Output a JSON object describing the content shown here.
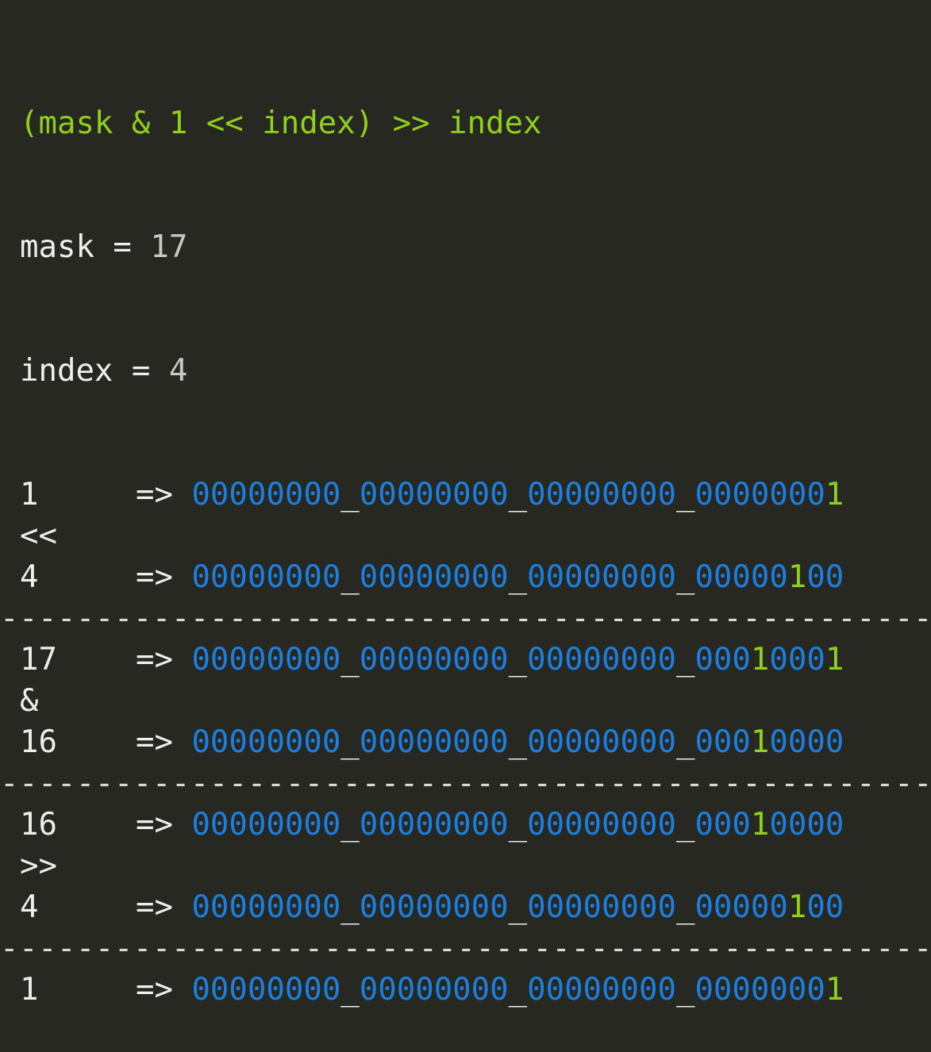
{
  "expression": "(mask & 1 << index) >> index",
  "vars": {
    "mask_name": "mask",
    "mask_eq": " = ",
    "mask_value": "17",
    "index_name": "index",
    "index_eq": " = ",
    "index_value": "4"
  },
  "arrow": "=>",
  "separator": "--------------------------------------------------",
  "rows": [
    {
      "label": "1",
      "bits": [
        "00000000",
        "00000000",
        "00000000",
        "0000000",
        "1"
      ],
      "highlight": [
        4
      ]
    },
    {
      "op": "<<"
    },
    {
      "label": "4",
      "bits": [
        "00000000",
        "00000000",
        "00000000",
        "00000",
        "1",
        "00"
      ],
      "highlight": [
        4
      ]
    },
    {
      "sep": true
    },
    {
      "label": "17",
      "bits": [
        "00000000",
        "00000000",
        "00000000",
        "000",
        "1",
        "000",
        "1"
      ],
      "highlight": [
        4,
        6
      ]
    },
    {
      "op": "&"
    },
    {
      "label": "16",
      "bits": [
        "00000000",
        "00000000",
        "00000000",
        "000",
        "1",
        "0000"
      ],
      "highlight": [
        4
      ]
    },
    {
      "sep": true
    },
    {
      "label": "16",
      "bits": [
        "00000000",
        "00000000",
        "00000000",
        "000",
        "1",
        "0000"
      ],
      "highlight": [
        4
      ]
    },
    {
      "op": ">>"
    },
    {
      "label": "4",
      "bits": [
        "00000000",
        "00000000",
        "00000000",
        "00000",
        "1",
        "00"
      ],
      "highlight": [
        4
      ]
    },
    {
      "sep": true
    },
    {
      "label": "1",
      "bits": [
        "00000000",
        "00000000",
        "00000000",
        "0000000",
        "1"
      ],
      "highlight": [
        4
      ]
    }
  ],
  "colors": {
    "background": "#272822",
    "header": "#8fd11a",
    "text": "#eeeeee",
    "number": "#c8c8c8",
    "bits": "#1c7fe0",
    "highlight_bit": "#8fd11a"
  }
}
